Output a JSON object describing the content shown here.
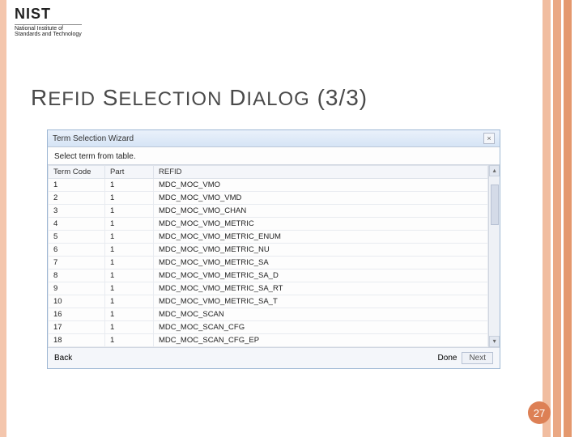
{
  "logo": {
    "main": "NIST",
    "sub1": "National Institute of",
    "sub2": "Standards and Technology"
  },
  "title": {
    "w1big": "R",
    "w1rest": "EFID",
    "w2big": "S",
    "w2rest": "ELECTION",
    "w3big": "D",
    "w3rest": "IALOG",
    "suffix": "(3/3)"
  },
  "dialog": {
    "title": "Term Selection Wizard",
    "close": "×",
    "instruction": "Select term from table.",
    "headers": {
      "termcode": "Term Code",
      "part": "Part",
      "refid": "REFID"
    },
    "rows": [
      {
        "termcode": "1",
        "part": "1",
        "refid": "MDC_MOC_VMO"
      },
      {
        "termcode": "2",
        "part": "1",
        "refid": "MDC_MOC_VMO_VMD"
      },
      {
        "termcode": "3",
        "part": "1",
        "refid": "MDC_MOC_VMO_CHAN"
      },
      {
        "termcode": "4",
        "part": "1",
        "refid": "MDC_MOC_VMO_METRIC"
      },
      {
        "termcode": "5",
        "part": "1",
        "refid": "MDC_MOC_VMO_METRIC_ENUM"
      },
      {
        "termcode": "6",
        "part": "1",
        "refid": "MDC_MOC_VMO_METRIC_NU"
      },
      {
        "termcode": "7",
        "part": "1",
        "refid": "MDC_MOC_VMO_METRIC_SA"
      },
      {
        "termcode": "8",
        "part": "1",
        "refid": "MDC_MOC_VMO_METRIC_SA_D"
      },
      {
        "termcode": "9",
        "part": "1",
        "refid": "MDC_MOC_VMO_METRIC_SA_RT"
      },
      {
        "termcode": "10",
        "part": "1",
        "refid": "MDC_MOC_VMO_METRIC_SA_T"
      },
      {
        "termcode": "16",
        "part": "1",
        "refid": "MDC_MOC_SCAN"
      },
      {
        "termcode": "17",
        "part": "1",
        "refid": "MDC_MOC_SCAN_CFG"
      },
      {
        "termcode": "18",
        "part": "1",
        "refid": "MDC_MOC_SCAN_CFG_EP"
      }
    ],
    "footer": {
      "back": "Back",
      "done": "Done",
      "next": "Next"
    }
  },
  "pageNumber": "27"
}
